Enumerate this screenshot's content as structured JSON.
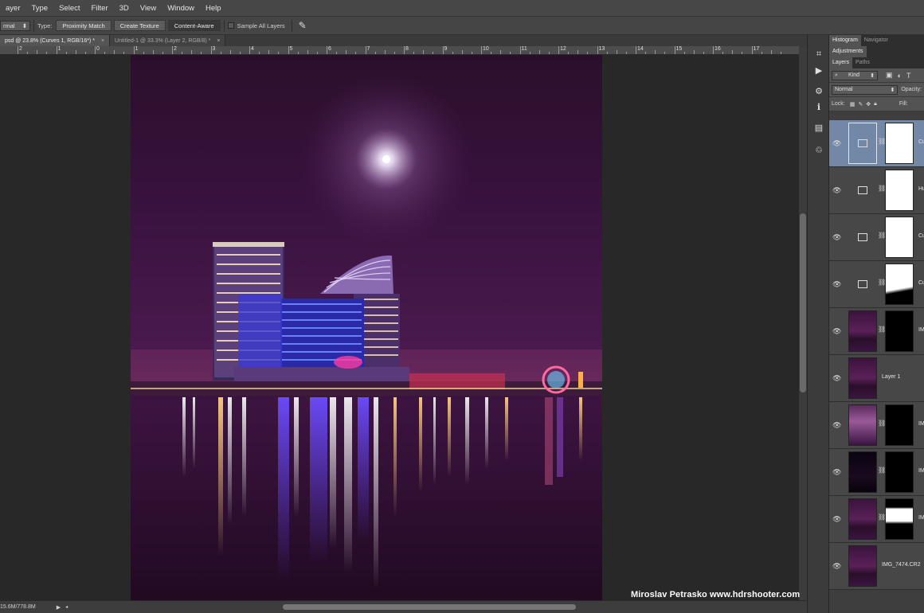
{
  "menu": [
    "ayer",
    "Type",
    "Select",
    "Filter",
    "3D",
    "View",
    "Window",
    "Help"
  ],
  "options": {
    "mode_value": "rmal",
    "type_label": "Type:",
    "buttons": [
      "Proximity Match",
      "Create Texture",
      "Content-Aware"
    ],
    "active_button_index": 2,
    "sample_all_label": "Sample All Layers"
  },
  "tabs": [
    {
      "label": "psd @ 23.8% (Curves 1, RGB/16*) *",
      "close": "×"
    },
    {
      "label": "Untitled-1 @ 33.3% (Layer 2, RGB/8) *",
      "close": "×"
    }
  ],
  "ruler": {
    "labels": [
      "2",
      "1",
      "0",
      "1",
      "2",
      "3",
      "4",
      "5",
      "6",
      "7",
      "8",
      "9",
      "10",
      "11",
      "12",
      "13",
      "14",
      "15",
      "16",
      "17"
    ]
  },
  "status": {
    "doc_size": "15.6M/778.8M"
  },
  "panels": {
    "top_tabs": [
      "Histogram",
      "Navigator"
    ],
    "adjustments_tab": "Adjustments",
    "layer_tabs": [
      "Layers",
      "Paths"
    ],
    "kind_label": "Kind",
    "blend_mode": "Normal",
    "opacity_label": "Opacity:",
    "lock_label": "Lock:",
    "fill_label": "Fill:"
  },
  "layers": [
    {
      "name": "Cu",
      "type": "curves",
      "mask": "white",
      "selected": true
    },
    {
      "name": "Hu",
      "type": "hue",
      "mask": "white",
      "selected": false
    },
    {
      "name": "Cu",
      "type": "curves",
      "mask": "white",
      "selected": false
    },
    {
      "name": "Cu",
      "type": "curves",
      "mask": "whiteblack",
      "selected": false
    },
    {
      "name": "IM",
      "type": "photo",
      "mask": "blackline",
      "selected": false
    },
    {
      "name": "Layer 1",
      "type": "photo",
      "mask": "none",
      "selected": false
    },
    {
      "name": "IM",
      "type": "photo-bright",
      "mask": "blackspeck",
      "selected": false
    },
    {
      "name": "IM",
      "type": "photo-dark",
      "mask": "blackspeck",
      "selected": false
    },
    {
      "name": "IM",
      "type": "photo",
      "mask": "blackwhite",
      "selected": false
    },
    {
      "name": "IMG_7474.CR2",
      "type": "photo",
      "mask": "none",
      "selected": false
    }
  ],
  "watermark": "Miroslav  Petrasko  www.hdrshooter.com",
  "colors": {
    "ui_dark": "#282828",
    "panel": "#3e3e3e",
    "selected_layer": "#7288a6",
    "sky": "#3a1340"
  },
  "icons": [
    "eye-icon",
    "link-icon",
    "curves-icon",
    "hue-saturation-icon",
    "play-icon",
    "info-icon",
    "brush-icon"
  ]
}
